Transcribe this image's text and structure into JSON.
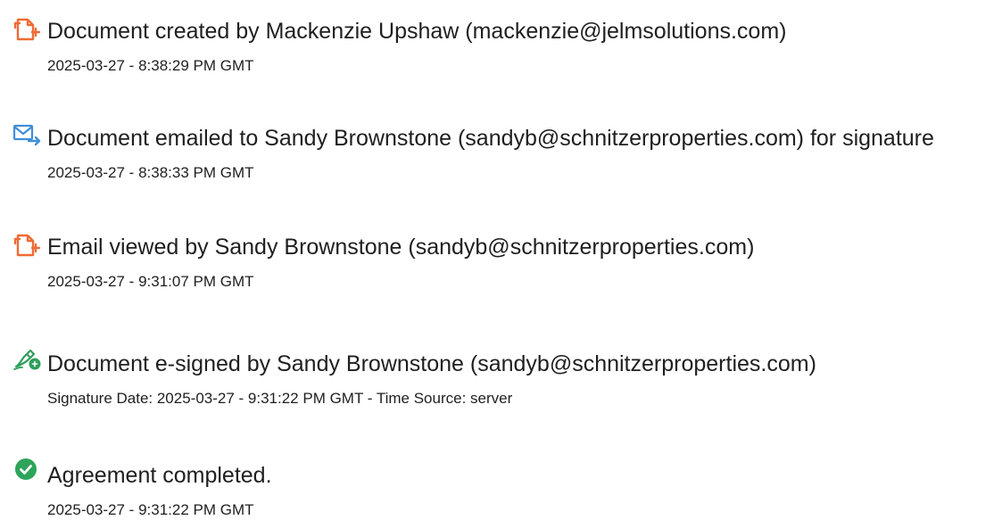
{
  "events": [
    {
      "icon": "document-icon",
      "title": "Document created by Mackenzie Upshaw (mackenzie@jelmsolutions.com)",
      "timestamp": "2025-03-27 - 8:38:29 PM GMT"
    },
    {
      "icon": "email-sent-icon",
      "title": "Document emailed to Sandy Brownstone (sandyb@schnitzerproperties.com) for signature",
      "timestamp": "2025-03-27 - 8:38:33 PM GMT"
    },
    {
      "icon": "document-icon",
      "title": "Email viewed by Sandy Brownstone (sandyb@schnitzerproperties.com)",
      "timestamp": "2025-03-27 - 9:31:07 PM GMT"
    },
    {
      "icon": "pen-sign-icon",
      "title": "Document e-signed by Sandy Brownstone (sandyb@schnitzerproperties.com)",
      "timestamp": "Signature Date: 2025-03-27 - 9:31:22 PM GMT - Time Source: server"
    },
    {
      "icon": "check-circle-icon",
      "title": "Agreement completed.",
      "timestamp": "2025-03-27 - 9:31:22 PM GMT"
    }
  ],
  "colors": {
    "document_icon": "#f06a35",
    "email_icon": "#3f8fd8",
    "sign_icon": "#2e9e5b",
    "check_icon": "#2ea45a",
    "text": "#1f1f1f"
  }
}
